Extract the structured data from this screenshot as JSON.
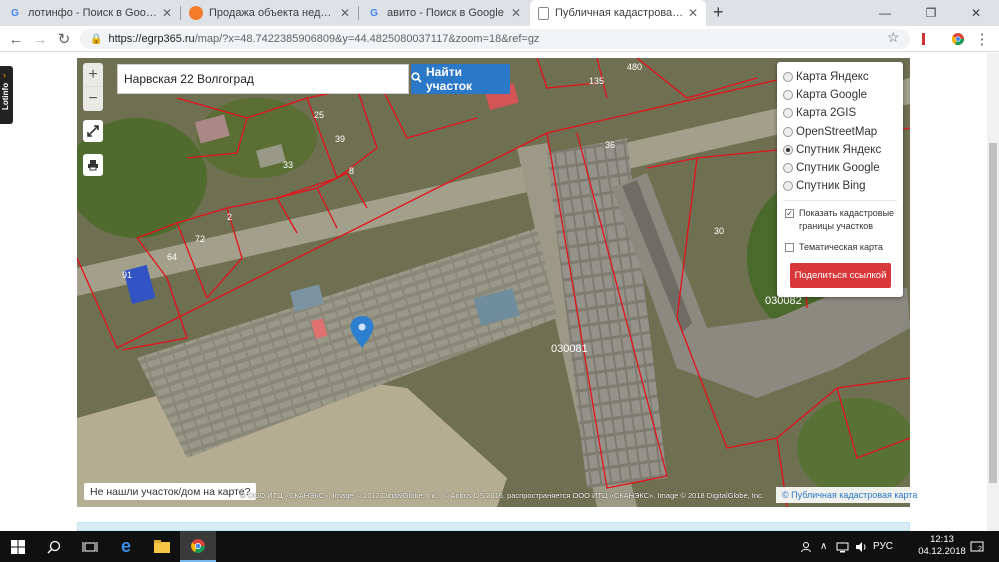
{
  "browser": {
    "tabs": [
      {
        "title": "лотинфо - Поиск в Google",
        "favicon": "google-icon",
        "active": false
      },
      {
        "title": "Продажа объекта недвижимост",
        "favicon": "avito-icon",
        "active": false
      },
      {
        "title": "авито - Поиск в Google",
        "favicon": "google-icon",
        "active": false
      },
      {
        "title": "Публичная кадастровая карта Е",
        "favicon": "page-icon",
        "active": true
      }
    ],
    "new_tab": "+",
    "url_host": "https://egrp365.ru",
    "url_rest": "/map/?x=48.7422385906809&y=44.4825080037117&zoom=18&ref=gz"
  },
  "map": {
    "search_value": "Нарвская 22 Волгоград",
    "search_button": "Найти участок",
    "zoom_in": "+",
    "zoom_out": "−",
    "layers": [
      {
        "label": "Карта Яндекс",
        "selected": false
      },
      {
        "label": "Карта Google",
        "selected": false
      },
      {
        "label": "Карта 2GIS",
        "selected": false
      },
      {
        "label": "OpenStreetMap",
        "selected": false
      },
      {
        "label": "Спутник Яндекс",
        "selected": true
      },
      {
        "label": "Спутник Google",
        "selected": false
      },
      {
        "label": "Спутник Bing",
        "selected": false
      }
    ],
    "show_borders_label": "Показать кадастровые границы участков",
    "show_borders_checked": true,
    "thematic_label": "Тематическая карта",
    "thematic_checked": false,
    "share_button": "Поделиться ссылкой",
    "not_found": "Не нашли участок/дом на карте?",
    "attribution": "© ООО ИТЦ «СКАНЭКС», Image © 2012 DigitalGlobe, Inc., © Airbus DS 2016, распространяется ООО ИТЦ «СКАНЭКС», Image © 2018 DigitalGlobe, Inc.",
    "pkk_link": "© Публичная кадастровая карта",
    "parcel_labels": [
      "480",
      "135",
      "25",
      "39",
      "33",
      "8",
      "2",
      "72",
      "64",
      "91",
      "30",
      "36",
      "030081",
      "030082"
    ],
    "colors": {
      "boundary": "#e8101a",
      "search_button": "#2c78c8",
      "share_button": "#d9383a"
    }
  },
  "sidebar_ext": {
    "label": "Lotinfo"
  },
  "taskbar": {
    "time": "12:13",
    "date": "04.12.2018",
    "lang": "РУС",
    "notifications": "2"
  }
}
